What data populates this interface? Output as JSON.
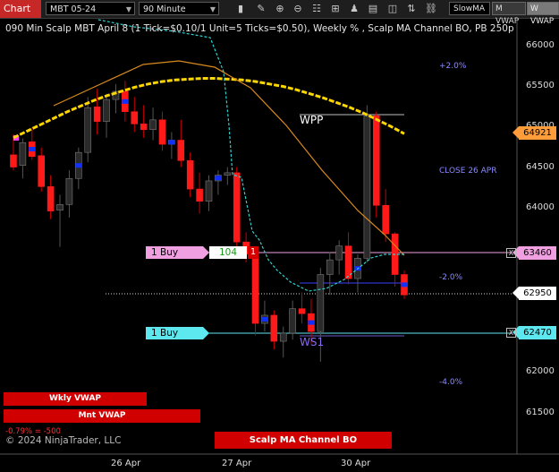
{
  "toolbar": {
    "chart_tab": "Chart",
    "instrument": "MBT 05-24",
    "interval": "90 Minute",
    "indicator_select": "SlowMA",
    "btn_m_vwap": "M VWAP",
    "btn_w_vwap": "W VWAP",
    "icons": [
      "bar-type-icon",
      "draw-tools-icon",
      "zoom-in-icon",
      "zoom-out-icon",
      "properties-icon",
      "indicators-icon",
      "strategies-icon",
      "templates-icon",
      "data-box-icon",
      "chart-trader-icon",
      "global-link-icon"
    ],
    "colors": {
      "chart_tab": "#c62828",
      "background": "#1e1e1e"
    }
  },
  "header": {
    "text": "090 Min Scalp MBT April 8 (1 Tick=$0.10/1 Unit=5 Ticks=$0.50), Weekly % , Scalp MA Channel BO, PB 250p"
  },
  "price_axis": {
    "labels": [
      "66000",
      "65500",
      "65000",
      "64500",
      "64000",
      "63500",
      "63000",
      "62500",
      "62000",
      "61500"
    ],
    "last_price": "64921",
    "buy_slm_price": "63460",
    "current_price": "62950",
    "buy_lmt_price": "62470"
  },
  "date_axis": {
    "labels": [
      "26 Apr",
      "27 Apr",
      "30 Apr"
    ]
  },
  "annotations": {
    "pct_plus2": "+2.0%",
    "close_label": "CLOSE 26 APR",
    "pct_minus2": "-2.0%",
    "pct_minus4": "-4.0%",
    "wpp": "WPP",
    "ws1": "WS1"
  },
  "orders": {
    "slm_label": "1 Buy SLM",
    "slm_qty": "104",
    "slm_count": "1",
    "lmt_label": "1 Buy LMT",
    "close_x": "X"
  },
  "bottom": {
    "wkly_vwap": "Wkly VWAP",
    "mnt_vwap": "Mnt VWAP",
    "vwap_val": "-0.79% = -500",
    "channel_bo": "Scalp MA Channel BO",
    "copyright": "© 2024 NinjaTrader, LLC"
  },
  "chart_data": {
    "type": "candlestick",
    "x_labels": [
      "26 Apr",
      "27 Apr",
      "30 Apr"
    ],
    "ylim": [
      61200,
      66250
    ],
    "candles": [
      {
        "o": 64670,
        "h": 64920,
        "l": 64480,
        "c": 64520
      },
      {
        "o": 64540,
        "h": 64870,
        "l": 64380,
        "c": 64820
      },
      {
        "o": 64830,
        "h": 65010,
        "l": 64610,
        "c": 64650
      },
      {
        "o": 64660,
        "h": 64760,
        "l": 64220,
        "c": 64280
      },
      {
        "o": 64280,
        "h": 64420,
        "l": 63880,
        "c": 63980
      },
      {
        "o": 63990,
        "h": 64180,
        "l": 63540,
        "c": 64060
      },
      {
        "o": 64060,
        "h": 64480,
        "l": 63900,
        "c": 64380
      },
      {
        "o": 64380,
        "h": 64760,
        "l": 64250,
        "c": 64700
      },
      {
        "o": 64700,
        "h": 65380,
        "l": 64580,
        "c": 65250
      },
      {
        "o": 65260,
        "h": 65480,
        "l": 64920,
        "c": 65080
      },
      {
        "o": 65080,
        "h": 65420,
        "l": 64880,
        "c": 65350
      },
      {
        "o": 65350,
        "h": 65540,
        "l": 65180,
        "c": 65450
      },
      {
        "o": 65450,
        "h": 65580,
        "l": 65080,
        "c": 65200
      },
      {
        "o": 65200,
        "h": 65380,
        "l": 64950,
        "c": 65050
      },
      {
        "o": 65050,
        "h": 65280,
        "l": 64880,
        "c": 64980
      },
      {
        "o": 64980,
        "h": 65250,
        "l": 64850,
        "c": 65100
      },
      {
        "o": 65100,
        "h": 65200,
        "l": 64720,
        "c": 64800
      },
      {
        "o": 64800,
        "h": 64950,
        "l": 64620,
        "c": 64850
      },
      {
        "o": 64850,
        "h": 65100,
        "l": 64520,
        "c": 64600
      },
      {
        "o": 64600,
        "h": 64700,
        "l": 64150,
        "c": 64250
      },
      {
        "o": 64250,
        "h": 64450,
        "l": 63950,
        "c": 64100
      },
      {
        "o": 64100,
        "h": 64420,
        "l": 63980,
        "c": 64350
      },
      {
        "o": 64350,
        "h": 64480,
        "l": 64180,
        "c": 64420
      },
      {
        "o": 64420,
        "h": 64520,
        "l": 64300,
        "c": 64450
      },
      {
        "o": 64450,
        "h": 64520,
        "l": 63400,
        "c": 63600
      },
      {
        "o": 63600,
        "h": 63720,
        "l": 63350,
        "c": 63450
      },
      {
        "o": 63440,
        "h": 63550,
        "l": 62450,
        "c": 62600
      },
      {
        "o": 62600,
        "h": 62880,
        "l": 62500,
        "c": 62700
      },
      {
        "o": 62700,
        "h": 62760,
        "l": 62280,
        "c": 62380
      },
      {
        "o": 62380,
        "h": 62560,
        "l": 62180,
        "c": 62480
      },
      {
        "o": 62480,
        "h": 62880,
        "l": 62400,
        "c": 62780
      },
      {
        "o": 62780,
        "h": 62980,
        "l": 62600,
        "c": 62720
      },
      {
        "o": 62720,
        "h": 62900,
        "l": 62350,
        "c": 62500
      },
      {
        "o": 62500,
        "h": 63280,
        "l": 62130,
        "c": 63200
      },
      {
        "o": 63200,
        "h": 63480,
        "l": 62950,
        "c": 63380
      },
      {
        "o": 63380,
        "h": 63620,
        "l": 63200,
        "c": 63550
      },
      {
        "o": 63550,
        "h": 63720,
        "l": 63080,
        "c": 63150
      },
      {
        "o": 63150,
        "h": 63450,
        "l": 62980,
        "c": 63400
      },
      {
        "o": 63400,
        "h": 65280,
        "l": 63350,
        "c": 65150
      },
      {
        "o": 65150,
        "h": 65200,
        "l": 63900,
        "c": 64050
      },
      {
        "o": 64050,
        "h": 64250,
        "l": 63600,
        "c": 63700
      },
      {
        "o": 63700,
        "h": 63720,
        "l": 63050,
        "c": 63200
      },
      {
        "o": 63200,
        "h": 63250,
        "l": 62900,
        "c": 62950
      }
    ],
    "slow_ma": [
      64880,
      64960,
      65040,
      65120,
      65200,
      65270,
      65340,
      65400,
      65450,
      65500,
      65540,
      65570,
      65590,
      65600,
      65610,
      65610,
      65600,
      65590,
      65570,
      65540,
      65510,
      65470,
      65420,
      65370,
      65310,
      65250,
      65180,
      65100,
      65020,
      64930
    ],
    "series_colors": {
      "up": "#2a2a2a",
      "down": "#ff1a1a",
      "slow_ma": "#ffd700",
      "orange_ma": "#d98a1c",
      "cyan_ma": "#30d0d0"
    }
  }
}
